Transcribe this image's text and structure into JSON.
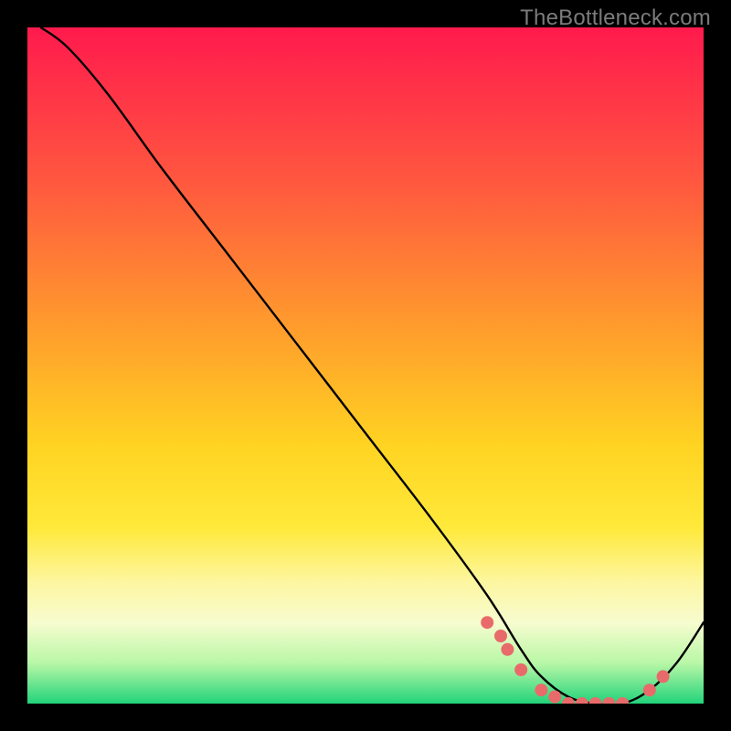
{
  "watermark": "TheBottleneck.com",
  "chart_data": {
    "type": "line",
    "title": "",
    "xlabel": "",
    "ylabel": "",
    "xlim": [
      0,
      100
    ],
    "ylim": [
      0,
      100
    ],
    "grid": false,
    "legend": false,
    "series": [
      {
        "name": "curve",
        "x": [
          2,
          6,
          12,
          20,
          30,
          40,
          50,
          60,
          68,
          73,
          76,
          80,
          84,
          88,
          92,
          96,
          100
        ],
        "y": [
          100,
          97,
          90,
          79,
          66,
          53,
          40,
          27,
          16,
          8,
          4,
          1,
          0,
          0,
          2,
          6,
          12
        ]
      },
      {
        "name": "scatter-points",
        "type": "scatter",
        "color": "#e96a6a",
        "x": [
          68,
          70,
          71,
          73,
          76,
          78,
          80,
          82,
          84,
          86,
          88,
          92,
          94
        ],
        "y": [
          12,
          10,
          8,
          5,
          2,
          1,
          0,
          0,
          0,
          0,
          0,
          2,
          4
        ]
      }
    ],
    "gradient_stops": [
      {
        "pos": 0.0,
        "color": "#ff1a4d"
      },
      {
        "pos": 0.22,
        "color": "#ff5540"
      },
      {
        "pos": 0.45,
        "color": "#ff9e2c"
      },
      {
        "pos": 0.62,
        "color": "#ffd422"
      },
      {
        "pos": 0.74,
        "color": "#ffe93a"
      },
      {
        "pos": 0.82,
        "color": "#fdf6a0"
      },
      {
        "pos": 0.88,
        "color": "#f7fccf"
      },
      {
        "pos": 0.94,
        "color": "#b9f7a7"
      },
      {
        "pos": 1.0,
        "color": "#22d37a"
      }
    ]
  }
}
